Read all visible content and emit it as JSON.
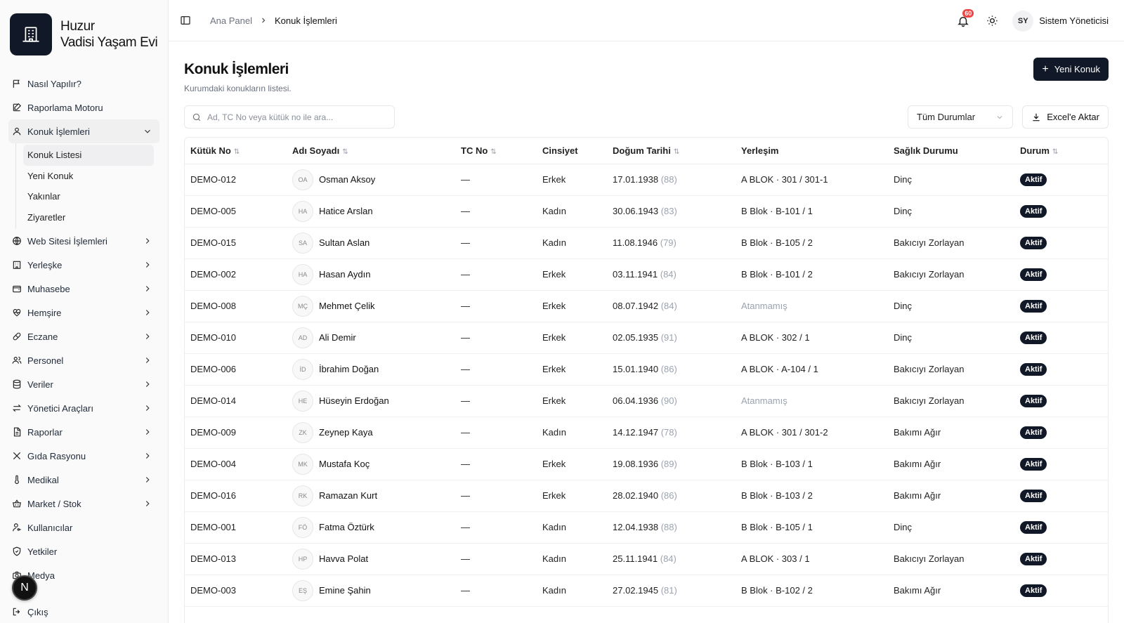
{
  "brand": {
    "line1": "Huzur",
    "line2": "Vadisi Yaşam Evi"
  },
  "sidebar": {
    "items_top": [
      {
        "label": "Nasıl Yapılır?",
        "icon": "flag-icon"
      },
      {
        "label": "Raporlama Motoru",
        "icon": "edit-icon"
      }
    ],
    "guest": {
      "label": "Konuk İşlemleri",
      "icon": "user-icon",
      "sub": [
        "Konuk Listesi",
        "Yeni Konuk",
        "Yakınlar",
        "Ziyaretler"
      ]
    },
    "items_bottom": [
      {
        "label": "Web Sitesi İşlemleri",
        "icon": "globe-icon"
      },
      {
        "label": "Yerleşke",
        "icon": "building-icon"
      },
      {
        "label": "Muhasebe",
        "icon": "wallet-icon"
      },
      {
        "label": "Hemşire",
        "icon": "heart-pulse-icon"
      },
      {
        "label": "Eczane",
        "icon": "pill-icon"
      },
      {
        "label": "Personel",
        "icon": "users-icon"
      },
      {
        "label": "Veriler",
        "icon": "database-icon"
      },
      {
        "label": "Yönetici Araçları",
        "icon": "arrows-icon"
      },
      {
        "label": "Raporlar",
        "icon": "file-text-icon"
      },
      {
        "label": "Gıda Rasyonu",
        "icon": "utensils-icon"
      },
      {
        "label": "Medikal",
        "icon": "thermometer-icon"
      },
      {
        "label": "Market / Stok",
        "icon": "basket-icon"
      }
    ],
    "items_plain": [
      {
        "label": "Kullanıcılar",
        "icon": "user-key-icon"
      },
      {
        "label": "Yetkiler",
        "icon": "shield-icon"
      },
      {
        "label": "Medya",
        "icon": "camera-icon"
      }
    ],
    "logout": "Çıkış",
    "n_badge": "N"
  },
  "header": {
    "crumb1": "Ana Panel",
    "crumb2": "Konuk İşlemleri",
    "notif_count": "60",
    "user_initials": "SY",
    "user_name": "Sistem Yöneticisi"
  },
  "page": {
    "title": "Konuk İşlemleri",
    "subtitle": "Kurumdaki konukların listesi.",
    "new_button": "Yeni Konuk",
    "search_placeholder": "Ad, TC No veya kütük no ile ara...",
    "status_select": "Tüm Durumlar",
    "excel_button": "Excel'e Aktar"
  },
  "table": {
    "columns": [
      "Kütük No",
      "Adı Soyadı",
      "TC No",
      "Cinsiyet",
      "Doğum Tarihi",
      "Yerleşim",
      "Sağlık Durumu",
      "Durum"
    ],
    "sortable": [
      true,
      true,
      true,
      false,
      true,
      false,
      false,
      true
    ],
    "rows": [
      {
        "kutuk": "DEMO-012",
        "ini": "OA",
        "name": "Osman Aksoy",
        "tc": "—",
        "gender": "Erkek",
        "dob": "17.01.1938",
        "age": "(88)",
        "place": "A BLOK · 301 / 301-1",
        "place_muted": false,
        "health": "Dinç",
        "status": "Aktif"
      },
      {
        "kutuk": "DEMO-005",
        "ini": "HA",
        "name": "Hatice Arslan",
        "tc": "—",
        "gender": "Kadın",
        "dob": "30.06.1943",
        "age": "(83)",
        "place": "B Blok · B-101 / 1",
        "place_muted": false,
        "health": "Dinç",
        "status": "Aktif"
      },
      {
        "kutuk": "DEMO-015",
        "ini": "SA",
        "name": "Sultan Aslan",
        "tc": "—",
        "gender": "Kadın",
        "dob": "11.08.1946",
        "age": "(79)",
        "place": "B Blok · B-105 / 2",
        "place_muted": false,
        "health": "Bakıcıyı Zorlayan",
        "status": "Aktif"
      },
      {
        "kutuk": "DEMO-002",
        "ini": "HA",
        "name": "Hasan Aydın",
        "tc": "—",
        "gender": "Erkek",
        "dob": "03.11.1941",
        "age": "(84)",
        "place": "B Blok · B-101 / 2",
        "place_muted": false,
        "health": "Bakıcıyı Zorlayan",
        "status": "Aktif"
      },
      {
        "kutuk": "DEMO-008",
        "ini": "MÇ",
        "name": "Mehmet Çelik",
        "tc": "—",
        "gender": "Erkek",
        "dob": "08.07.1942",
        "age": "(84)",
        "place": "Atanmamış",
        "place_muted": true,
        "health": "Dinç",
        "status": "Aktif"
      },
      {
        "kutuk": "DEMO-010",
        "ini": "AD",
        "name": "Ali Demir",
        "tc": "—",
        "gender": "Erkek",
        "dob": "02.05.1935",
        "age": "(91)",
        "place": "A BLOK · 302 / 1",
        "place_muted": false,
        "health": "Dinç",
        "status": "Aktif"
      },
      {
        "kutuk": "DEMO-006",
        "ini": "İD",
        "name": "İbrahim Doğan",
        "tc": "—",
        "gender": "Erkek",
        "dob": "15.01.1940",
        "age": "(86)",
        "place": "A BLOK · A-104 / 1",
        "place_muted": false,
        "health": "Bakıcıyı Zorlayan",
        "status": "Aktif"
      },
      {
        "kutuk": "DEMO-014",
        "ini": "HE",
        "name": "Hüseyin Erdoğan",
        "tc": "—",
        "gender": "Erkek",
        "dob": "06.04.1936",
        "age": "(90)",
        "place": "Atanmamış",
        "place_muted": true,
        "health": "Bakıcıyı Zorlayan",
        "status": "Aktif"
      },
      {
        "kutuk": "DEMO-009",
        "ini": "ZK",
        "name": "Zeynep Kaya",
        "tc": "—",
        "gender": "Kadın",
        "dob": "14.12.1947",
        "age": "(78)",
        "place": "A BLOK · 301 / 301-2",
        "place_muted": false,
        "health": "Bakımı Ağır",
        "status": "Aktif"
      },
      {
        "kutuk": "DEMO-004",
        "ini": "MK",
        "name": "Mustafa Koç",
        "tc": "—",
        "gender": "Erkek",
        "dob": "19.08.1936",
        "age": "(89)",
        "place": "B Blok · B-103 / 1",
        "place_muted": false,
        "health": "Bakımı Ağır",
        "status": "Aktif"
      },
      {
        "kutuk": "DEMO-016",
        "ini": "RK",
        "name": "Ramazan Kurt",
        "tc": "—",
        "gender": "Erkek",
        "dob": "28.02.1940",
        "age": "(86)",
        "place": "B Blok · B-103 / 2",
        "place_muted": false,
        "health": "Bakımı Ağır",
        "status": "Aktif"
      },
      {
        "kutuk": "DEMO-001",
        "ini": "FÖ",
        "name": "Fatma Öztürk",
        "tc": "—",
        "gender": "Kadın",
        "dob": "12.04.1938",
        "age": "(88)",
        "place": "B Blok · B-105 / 1",
        "place_muted": false,
        "health": "Dinç",
        "status": "Aktif"
      },
      {
        "kutuk": "DEMO-013",
        "ini": "HP",
        "name": "Havva Polat",
        "tc": "—",
        "gender": "Kadın",
        "dob": "25.11.1941",
        "age": "(84)",
        "place": "A BLOK · 303 / 1",
        "place_muted": false,
        "health": "Bakıcıyı Zorlayan",
        "status": "Aktif"
      },
      {
        "kutuk": "DEMO-003",
        "ini": "EŞ",
        "name": "Emine Şahin",
        "tc": "—",
        "gender": "Kadın",
        "dob": "27.02.1945",
        "age": "(81)",
        "place": "B Blok · B-102 / 2",
        "place_muted": false,
        "health": "Bakımı Ağır",
        "status": "Aktif"
      }
    ]
  }
}
